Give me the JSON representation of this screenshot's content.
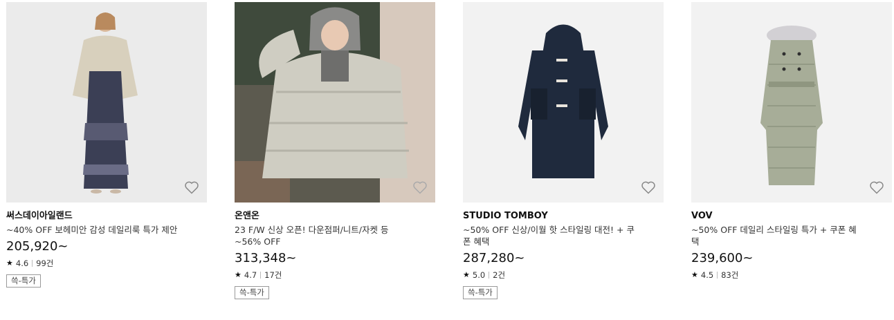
{
  "products": [
    {
      "brand": "써스데이아일랜드",
      "description": "~40% OFF 보헤미안 감성 데일리룩 특가 제안",
      "price": "205,920~",
      "rating": "4.6",
      "reviews": "99건",
      "tag": "쓱-특가",
      "wishlist_icon": "heart-outline"
    },
    {
      "brand": "온앤온",
      "description": "23 F/W 신상 오픈! 다운점퍼/니트/자켓 등 ~56% OFF",
      "price": "313,348~",
      "rating": "4.7",
      "reviews": "17건",
      "tag": "쓱-특가",
      "wishlist_icon": "heart-outline"
    },
    {
      "brand": "STUDIO TOMBOY",
      "description": "~50% OFF 신상/이월 핫 스타일링 대전! + 쿠폰 혜택",
      "price": "287,280~",
      "rating": "5.0",
      "reviews": "2건",
      "tag": "쓱-특가",
      "wishlist_icon": "heart-outline"
    },
    {
      "brand": "VOV",
      "description": "~50% OFF 데일리 스타일링 특가 + 쿠폰 혜택",
      "price": "239,600~",
      "rating": "4.5",
      "reviews": "83건",
      "wishlist_icon": "heart-outline"
    }
  ],
  "colors": {
    "image_bg_light": "#f2f2f2",
    "text_primary": "#111111",
    "tag_border": "#999999"
  }
}
